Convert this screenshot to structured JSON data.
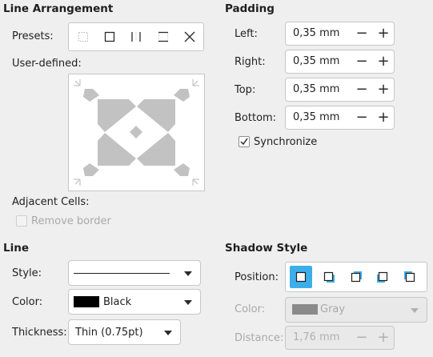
{
  "line_arrangement": {
    "title": "Line Arrangement",
    "presets_label": "Presets:",
    "presets": [
      {
        "icon": "no-borders-icon"
      },
      {
        "icon": "outer-border-icon"
      },
      {
        "icon": "left-right-borders-icon"
      },
      {
        "icon": "top-bottom-borders-icon"
      },
      {
        "icon": "diagonal-borders-icon"
      }
    ],
    "user_defined_label": "User-defined:",
    "adjacent_cells_label": "Adjacent Cells:",
    "remove_border_label": "Remove border"
  },
  "padding": {
    "title": "Padding",
    "left_label": "Left:",
    "left_value": "0,35 mm",
    "right_label": "Right:",
    "right_value": "0,35 mm",
    "top_label": "Top:",
    "top_value": "0,35 mm",
    "bottom_label": "Bottom:",
    "bottom_value": "0,35 mm",
    "synchronize_label": "Synchronize",
    "synchronize_checked": true
  },
  "line": {
    "title": "Line",
    "style_label": "Style:",
    "color_label": "Color:",
    "color_value": "Black",
    "color_swatch": "#000000",
    "thickness_label": "Thickness:",
    "thickness_value": "Thin (0.75pt)"
  },
  "shadow": {
    "title": "Shadow Style",
    "position_label": "Position:",
    "positions": [
      "no-shadow-icon",
      "shadow-bottom-right-icon",
      "shadow-top-right-icon",
      "shadow-bottom-left-icon",
      "shadow-top-left-icon"
    ],
    "selected_color": "#3daee9",
    "color_label": "Color:",
    "color_value": "Gray",
    "color_swatch": "#808080",
    "distance_label": "Distance:",
    "distance_value": "1,76 mm"
  }
}
